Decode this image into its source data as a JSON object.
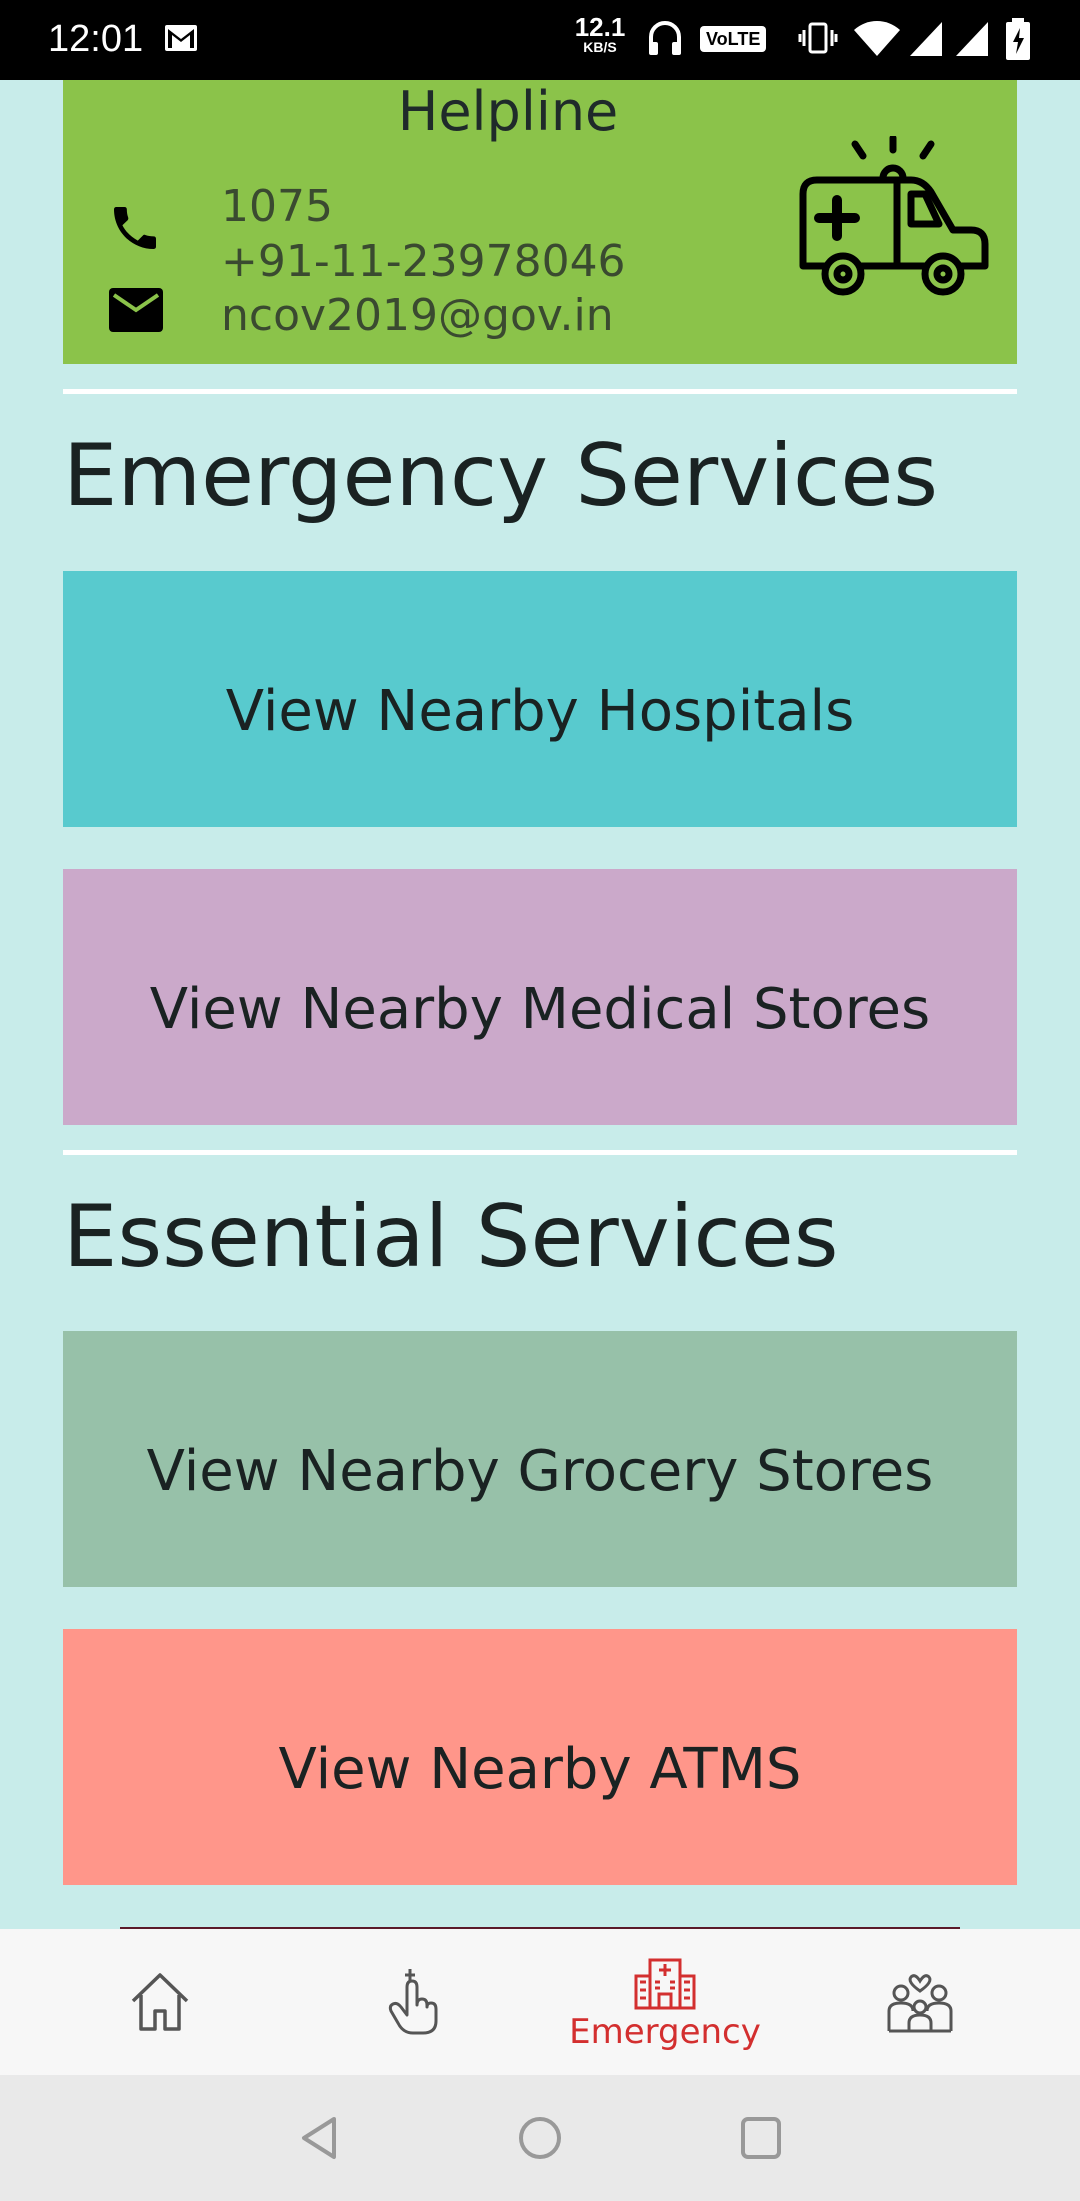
{
  "status_bar": {
    "time": "12:01",
    "speed_value": "12.1",
    "speed_unit": "KB/S",
    "volte": "VoLTE",
    "icons": [
      "gmail-icon",
      "headphones-icon",
      "vibrate-icon",
      "wifi-icon",
      "signal-icon",
      "signal-icon",
      "battery-charging-icon"
    ]
  },
  "helpline": {
    "title": "Helpline",
    "numbers": [
      "1075",
      "+91-11-23978046"
    ],
    "email": "ncov2019@gov.in",
    "icons": [
      "phone-icon",
      "mail-icon",
      "ambulance-icon"
    ],
    "background": "#8bc34a"
  },
  "emergency": {
    "title": "Emergency Services",
    "buttons": [
      {
        "label": "View Nearby Hospitals",
        "color": "#58cace"
      },
      {
        "label": "View Nearby Medical Stores",
        "color": "#cba9ca"
      }
    ]
  },
  "essential": {
    "title": "Essential Services",
    "buttons": [
      {
        "label": "View Nearby Grocery Stores",
        "color": "#97c1a9"
      },
      {
        "label": "View Nearby ATMS",
        "color": "#ff968a"
      }
    ]
  },
  "bottom_nav": {
    "items": [
      {
        "icon": "home-icon",
        "label": ""
      },
      {
        "icon": "hand-pointer-icon",
        "label": ""
      },
      {
        "icon": "hospital-icon",
        "label": "Emergency",
        "active": true
      },
      {
        "icon": "family-icon",
        "label": ""
      }
    ],
    "active_color": "#d32f2f"
  },
  "system_nav": {
    "icons": [
      "back-icon",
      "home-circle-icon",
      "recents-icon"
    ]
  }
}
